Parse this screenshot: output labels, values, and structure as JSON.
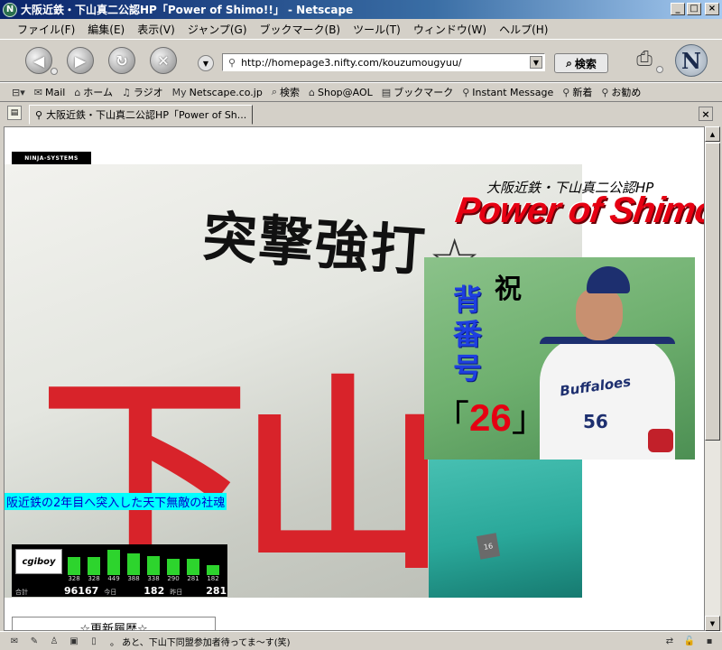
{
  "window": {
    "title": "大阪近鉄・下山真二公認HP「Power of Shimo!!」 - Netscape",
    "app_icon": "N"
  },
  "menu": [
    "ファイル(F)",
    "編集(E)",
    "表示(V)",
    "ジャンプ(G)",
    "ブックマーク(B)",
    "ツール(T)",
    "ウィンドウ(W)",
    "ヘルプ(H)"
  ],
  "nav": {
    "url": "http://homepage3.nifty.com/kouzumougyuu/",
    "search_label": "検索",
    "logo": "N"
  },
  "personal_toolbar": [
    {
      "icon": "mail-icon",
      "glyph": "✉",
      "label": "Mail"
    },
    {
      "icon": "home-icon",
      "glyph": "⌂",
      "label": "ホーム"
    },
    {
      "icon": "radio-icon",
      "glyph": "♫",
      "label": "ラジオ"
    },
    {
      "icon": "netscape-icon",
      "glyph": "My",
      "label": "Netscape.co.jp"
    },
    {
      "icon": "search-icon",
      "glyph": "⌕",
      "label": "検索"
    },
    {
      "icon": "shop-icon",
      "glyph": "⌂",
      "label": "Shop@AOL"
    },
    {
      "icon": "bookmark-icon",
      "glyph": "▤",
      "label": "ブックマーク"
    },
    {
      "icon": "link-icon",
      "glyph": "⚲",
      "label": "Instant Message"
    },
    {
      "icon": "link-icon",
      "glyph": "⚲",
      "label": "新着"
    },
    {
      "icon": "link-icon",
      "glyph": "⚲",
      "label": "お勧め"
    }
  ],
  "tab": {
    "title": "大阪近鉄・下山真二公認HP「Power of Sh..."
  },
  "page": {
    "ninja_badge": "NINJA-SYSTEMS",
    "banner_text": "突撃強打",
    "big_kanji": "下山真",
    "headline_sub": "大阪近鉄・下山真二公認HP",
    "headline_main": "Power of Shimo!!",
    "inset": {
      "celebrate": "祝",
      "vertical_title": "背番号",
      "number": "26",
      "bracket_open": "「",
      "bracket_close": "」",
      "jersey_logo": "Buffaloes",
      "jersey_number": "56"
    },
    "seat_number": "16",
    "caption": "阪近鉄の2年目へ突入した天下無敵の社魂",
    "history_title": "☆更新履歴☆"
  },
  "counter": {
    "logo": "cgiboy",
    "bars": [
      {
        "value": 328
      },
      {
        "value": 328
      },
      {
        "value": 449
      },
      {
        "value": 388
      },
      {
        "value": 338
      },
      {
        "value": 290
      },
      {
        "value": 281
      },
      {
        "value": 182
      }
    ],
    "total_label": "合計",
    "total": "96167",
    "today_label": "今日",
    "today": "182",
    "yesterday_label": "昨日",
    "yesterday": "281"
  },
  "status": {
    "text": "。 あと、下山下同盟参加者待ってま〜す(笑)"
  },
  "colors": {
    "headline": "#e60012",
    "caption_bg": "#00ffff",
    "caption_text": "#0000cc",
    "counter_bar": "#2dd42d",
    "title_bar": "#0a246a"
  }
}
